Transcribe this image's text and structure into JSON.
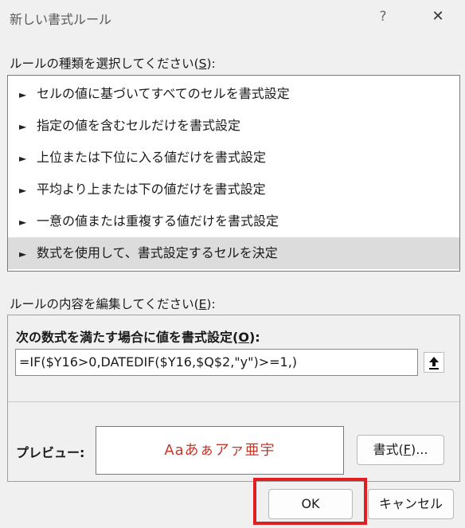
{
  "window": {
    "title": "新しい書式ルール",
    "help_label": "?",
    "close_label": "✕"
  },
  "rule_type": {
    "label_prefix": "ルールの種類を選択してください(",
    "label_key": "S",
    "label_suffix": "):",
    "items": [
      {
        "label": "セルの値に基づいてすべてのセルを書式設定"
      },
      {
        "label": "指定の値を含むセルだけを書式設定"
      },
      {
        "label": "上位または下位に入る値だけを書式設定"
      },
      {
        "label": "平均より上または下の値だけを書式設定"
      },
      {
        "label": "一意の値または重複する値だけを書式設定"
      },
      {
        "label": "数式を使用して、書式設定するセルを決定",
        "selected": true
      }
    ]
  },
  "rule_edit": {
    "label_prefix": "ルールの内容を編集してください(",
    "label_key": "E",
    "label_suffix": "):",
    "formula_label_prefix": "次の数式を満たす場合に値を書式設定(",
    "formula_label_key": "O",
    "formula_label_suffix": "):",
    "formula_value": "=IF($Y16>0,DATEDIF($Y16,$Q$2,\"y\")>=1,)",
    "preview_label": "プレビュー:",
    "preview_text": "Aaあぁアァ亜宇",
    "format_button_prefix": "書式(",
    "format_button_key": "F",
    "format_button_suffix": ")..."
  },
  "buttons": {
    "ok": "OK",
    "cancel": "キャンセル"
  },
  "colors": {
    "highlight": "#e02020",
    "preview_text": "#c0392b",
    "selected_row": "#dcdcdc"
  },
  "icons": {
    "rule_bullet": "►",
    "collapse": "upload-arrow"
  }
}
